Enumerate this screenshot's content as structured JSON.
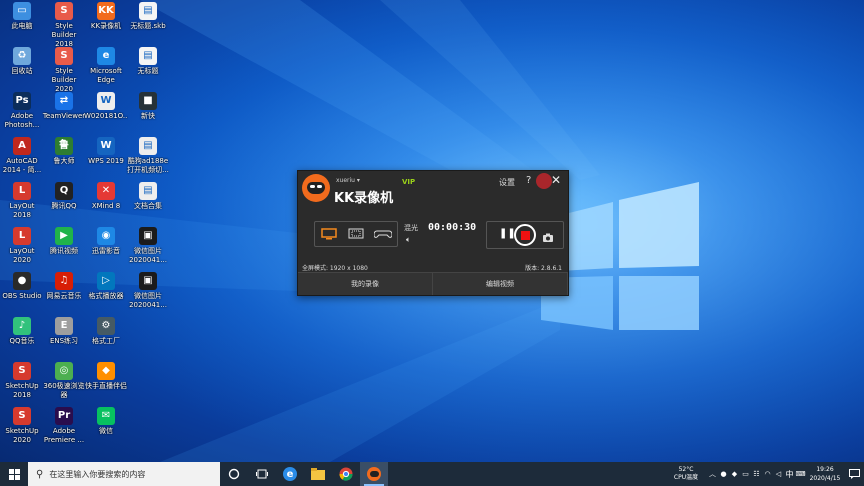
{
  "desktop": {
    "icons": [
      {
        "label": "此电脑",
        "icon": "computer-icon",
        "color": "#3d8fe0",
        "glyph": "▭"
      },
      {
        "label": "回收站",
        "icon": "recycle-bin-icon",
        "color": "#6fa8dc",
        "glyph": "♻"
      },
      {
        "label": "Adobe\nPhotosh...",
        "icon": "photoshop-icon",
        "color": "#0b2d5b",
        "glyph": "Ps"
      },
      {
        "label": "AutoCAD\n2014 - 简...",
        "icon": "autocad-icon",
        "color": "#c0281e",
        "glyph": "A"
      },
      {
        "label": "LayOut 2018",
        "icon": "layout-icon",
        "color": "#d63a2e",
        "glyph": "L"
      },
      {
        "label": "LayOut 2020",
        "icon": "layout-icon",
        "color": "#d63a2e",
        "glyph": "L"
      },
      {
        "label": "OBS Studio",
        "icon": "obs-icon",
        "color": "#2a2a2a",
        "glyph": "●"
      },
      {
        "label": "QQ音乐",
        "icon": "qq-music-icon",
        "color": "#31c27c",
        "glyph": "♪"
      },
      {
        "label": "SketchUp\n2018",
        "icon": "sketchup-icon",
        "color": "#d63a2e",
        "glyph": "S"
      },
      {
        "label": "SketchUp\n2020",
        "icon": "sketchup-icon",
        "color": "#d63a2e",
        "glyph": "S"
      },
      {
        "label": "Style Builder\n2018",
        "icon": "style-builder-icon",
        "color": "#e85b4a",
        "glyph": "S"
      },
      {
        "label": "Style Builder\n2020",
        "icon": "style-builder-icon",
        "color": "#e85b4a",
        "glyph": "S"
      },
      {
        "label": "TeamViewer",
        "icon": "teamviewer-icon",
        "color": "#1a73e8",
        "glyph": "⇄"
      },
      {
        "label": "鲁大师",
        "icon": "ludashi-icon",
        "color": "#2e7d32",
        "glyph": "鲁"
      },
      {
        "label": "腾讯QQ",
        "icon": "qq-icon",
        "color": "#222",
        "glyph": "Q"
      },
      {
        "label": "腾讯视频",
        "icon": "tencent-video-icon",
        "color": "#20b34a",
        "glyph": "▶"
      },
      {
        "label": "网易云音乐",
        "icon": "netease-music-icon",
        "color": "#d81e06",
        "glyph": "♫"
      },
      {
        "label": "ENS练习",
        "icon": "ens-icon",
        "color": "#9e9e9e",
        "glyph": "E"
      },
      {
        "label": "360极速浏览\n器",
        "icon": "360-browser-icon",
        "color": "#4caf50",
        "glyph": "◎"
      },
      {
        "label": "Adobe\nPremiere ...",
        "icon": "premiere-icon",
        "color": "#2a0d4d",
        "glyph": "Pr"
      },
      {
        "label": "KK录像机",
        "icon": "kk-recorder-icon",
        "color": "#f26b1d",
        "glyph": "KK"
      },
      {
        "label": "Microsoft\nEdge",
        "icon": "edge-icon",
        "color": "#1e88e5",
        "glyph": "e"
      },
      {
        "label": "W020181O...",
        "icon": "document-icon",
        "color": "#eeeeee",
        "glyph": "W"
      },
      {
        "label": "WPS 2019",
        "icon": "wps-icon",
        "color": "#1565c0",
        "glyph": "W"
      },
      {
        "label": "XMind 8",
        "icon": "xmind-icon",
        "color": "#e53935",
        "glyph": "✕"
      },
      {
        "label": "迅雷影音",
        "icon": "xunlei-icon",
        "color": "#1e88e5",
        "glyph": "◉"
      },
      {
        "label": "格式播放器",
        "icon": "player-icon",
        "color": "#0277bd",
        "glyph": "▷"
      },
      {
        "label": "格式工厂",
        "icon": "format-factory-icon",
        "color": "#455a64",
        "glyph": "⚙"
      },
      {
        "label": "快手直播伴侣",
        "icon": "kuaishou-icon",
        "color": "#ff8f00",
        "glyph": "◆"
      },
      {
        "label": "微信",
        "icon": "wechat-icon",
        "color": "#07c160",
        "glyph": "✉"
      },
      {
        "label": "无标题.skb",
        "icon": "file-icon",
        "color": "#f5f5f5",
        "glyph": "▤"
      },
      {
        "label": "无标题",
        "icon": "file-icon",
        "color": "#f5f5f5",
        "glyph": "▤"
      },
      {
        "label": "新快",
        "icon": "file-icon",
        "color": "#263238",
        "glyph": "■"
      },
      {
        "label": "酷狗ad188e\n打开机频切...",
        "icon": "file-icon",
        "color": "#eeeeee",
        "glyph": "▤"
      },
      {
        "label": "文档合集",
        "icon": "file-icon",
        "color": "#eeeeee",
        "glyph": "▤"
      },
      {
        "label": "微信图片\n2020041...",
        "icon": "image-file-icon",
        "color": "#1b1b1b",
        "glyph": "▣"
      },
      {
        "label": "微信图片\n2020041...",
        "icon": "image-file-icon",
        "color": "#1b1b1b",
        "glyph": "▣"
      }
    ]
  },
  "kk": {
    "username": "xueriu",
    "title": "KK录像机",
    "vip": "VIP",
    "settings": "设置",
    "help": "?",
    "close": "✕",
    "audio_label": "混光",
    "timer": "00:00:30",
    "resolution": "全屏模式: 1920 x 1080",
    "version": "版本: 2.8.6.1",
    "my_recordings": "我的录像",
    "edit_video": "编辑视频",
    "accent": "#f26b1d"
  },
  "taskbar": {
    "search_placeholder": "在这里输入你要搜索的内容",
    "temp": "52°C",
    "temp_label": "CPU温度",
    "ime": "中",
    "time": "19:26",
    "date": "2020/4/15"
  }
}
